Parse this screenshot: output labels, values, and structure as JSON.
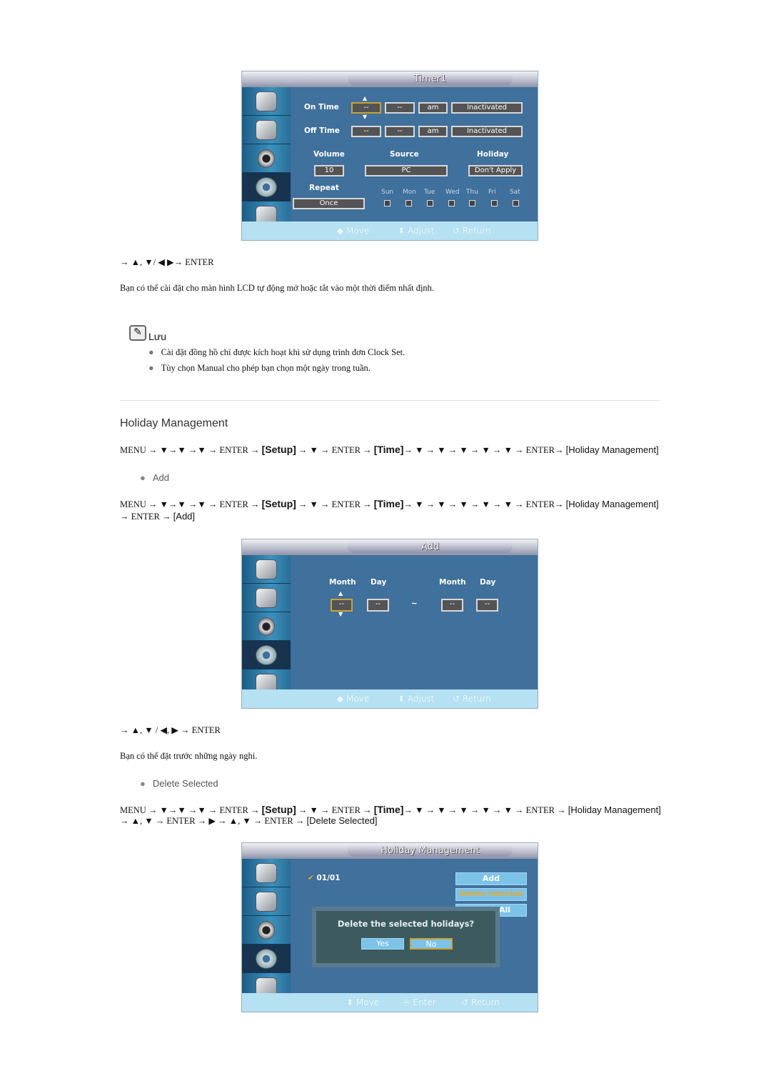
{
  "timer_screen": {
    "title": "Timer1",
    "on_time_label": "On Time",
    "off_time_label": "Off Time",
    "on_time": [
      "--",
      "--",
      "am",
      "Inactivated"
    ],
    "off_time": [
      "--",
      "--",
      "am",
      "Inactivated"
    ],
    "volume_label": "Volume",
    "volume_value": "10",
    "source_label": "Source",
    "source_value": "PC",
    "holiday_label": "Holiday",
    "holiday_value": "Don't Apply",
    "repeat_label": "Repeat",
    "repeat_value": "Once",
    "days": [
      "Sun",
      "Mon",
      "Tue",
      "Wed",
      "Thu",
      "Fri",
      "Sat"
    ],
    "footer": {
      "move": "Move",
      "adjust": "Adjust",
      "return": "Return"
    }
  },
  "timer_nav": "→ ▲, ▼/ ◀ ▶→ ENTER",
  "timer_desc": "Bạn có thể cài đặt cho màn hình LCD tự động mở hoặc tắt vào một thời điểm nhất định.",
  "note": {
    "title": "Lưu",
    "items": [
      "Cài đặt đồng hồ chỉ được kích hoạt khi sử dụng trình đơn Clock Set.",
      "Tùy chọn Manual cho phép bạn chọn một ngày trong tuần."
    ]
  },
  "holiday": {
    "heading": "Holiday Management",
    "path1": [
      {
        "t": "MENU → ▼→▼ →▼ → ENTER → "
      },
      {
        "t": "[Setup]",
        "s": "b"
      },
      {
        "t": " → ▼ → ENTER → "
      },
      {
        "t": "[Time]",
        "s": "b"
      },
      {
        "t": "→ ▼ → ▼ → ▼ → ▼ → ▼ → ENTER→ "
      },
      {
        "t": "[Holiday Management]",
        "s": "s"
      }
    ],
    "add_bullet": "Add",
    "path2": [
      {
        "t": "MENU → ▼→▼ →▼ → ENTER → "
      },
      {
        "t": "[Setup]",
        "s": "b"
      },
      {
        "t": " → ▼ → ENTER → "
      },
      {
        "t": "[Time]",
        "s": "b"
      },
      {
        "t": "→ ▼ → ▼ → ▼ → ▼ → ▼ → ENTER→ "
      },
      {
        "t": "[Holiday Management]",
        "s": "s"
      }
    ],
    "path2b": [
      {
        "t": "→ ENTER → "
      },
      {
        "t": "[Add]",
        "s": "s"
      }
    ],
    "add_nav": "→ ▲, ▼ / ◀, ▶ → ENTER",
    "add_desc": "Bạn có thể đặt trước những ngày nghỉ.",
    "delete_bullet": "Delete Selected",
    "path3": [
      {
        "t": "MENU → ▼→▼ →▼ → ENTER → "
      },
      {
        "t": "[Setup]",
        "s": "b"
      },
      {
        "t": " → ▼ → ENTER → "
      },
      {
        "t": "[Time]",
        "s": "b"
      },
      {
        "t": "→ ▼ → ▼ → ▼ → ▼ → ▼ → ENTER → "
      },
      {
        "t": "[Holiday Management]",
        "s": "s"
      }
    ],
    "path3b": [
      {
        "t": "→ ▲, ▼ → ENTER → ▶ → ▲, ▼ → ENTER → "
      },
      {
        "t": "[Delete Selected]",
        "s": "s"
      }
    ]
  },
  "add_screen": {
    "title": "Add",
    "month": "Month",
    "day": "Day",
    "sep": "~",
    "value": "--",
    "footer": {
      "move": "Move",
      "adjust": "Adjust",
      "return": "Return"
    }
  },
  "hm_screen": {
    "title": "Holiday Management",
    "entry": "01/01",
    "buttons": [
      "Add",
      "Delete Selected",
      "All"
    ],
    "dialog": {
      "message": "Delete the selected holidays?",
      "yes": "Yes",
      "no": "No"
    },
    "footer": {
      "move": "Move",
      "enter": "Enter",
      "return": "Return"
    }
  },
  "colors": {
    "screen_bg": "#40709c",
    "highlight": "#c9a437",
    "footer": "#b5e1f3",
    "button": "#7cc3ea"
  }
}
